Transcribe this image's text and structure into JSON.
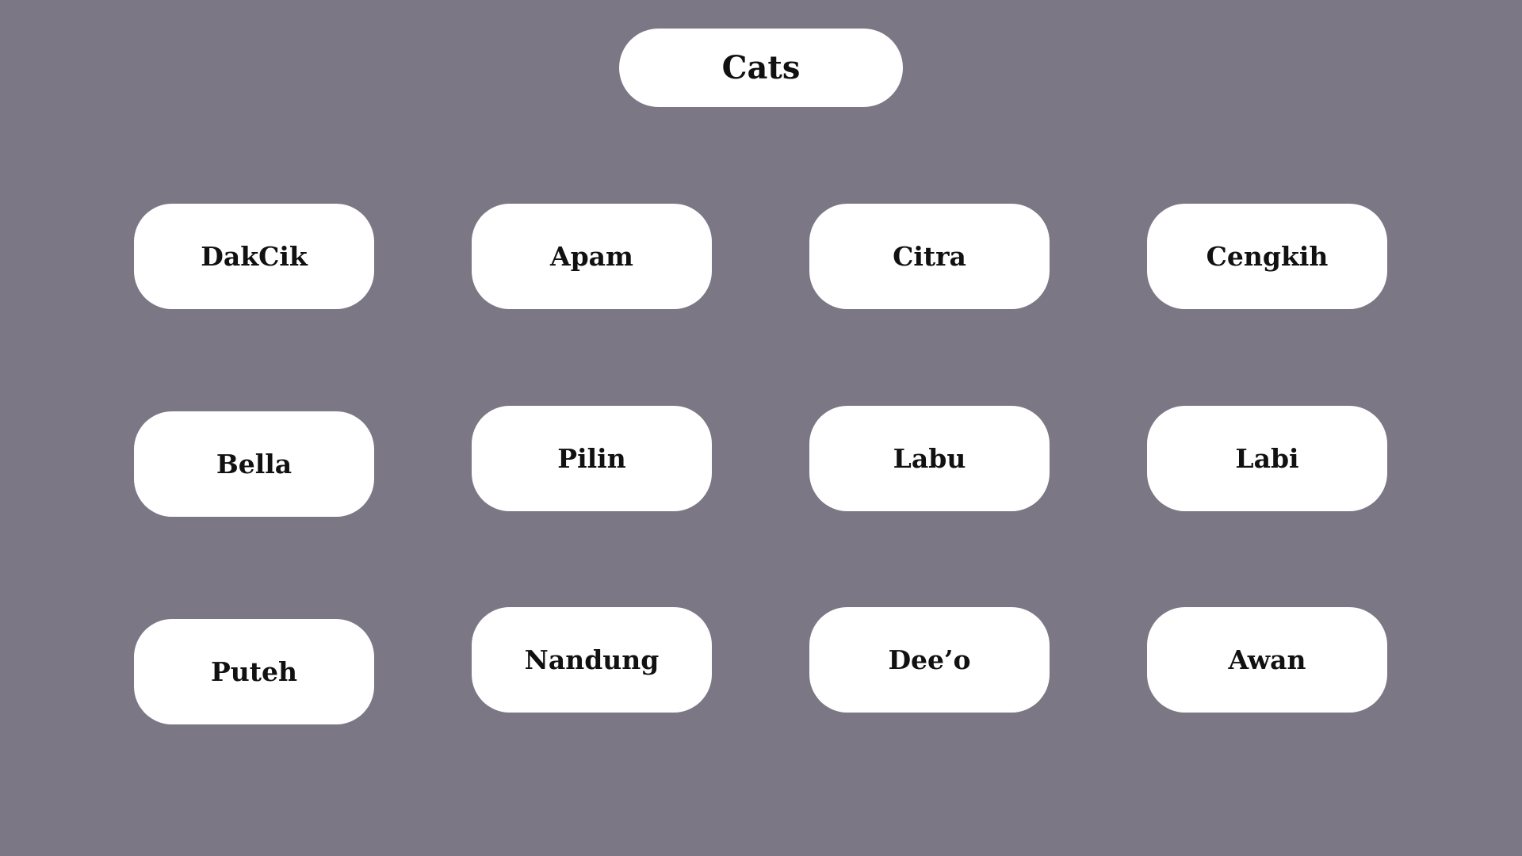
{
  "title": "Cats",
  "colors": {
    "background": "#7b7785",
    "pill": "#ffffff",
    "text": "#111111"
  },
  "cats": [
    "DakCik",
    "Apam",
    "Citra",
    "Cengkih",
    "Bella",
    "Pilin",
    "Labu",
    "Labi",
    "Puteh",
    "Nandung",
    "Dee’o",
    "Awan"
  ]
}
